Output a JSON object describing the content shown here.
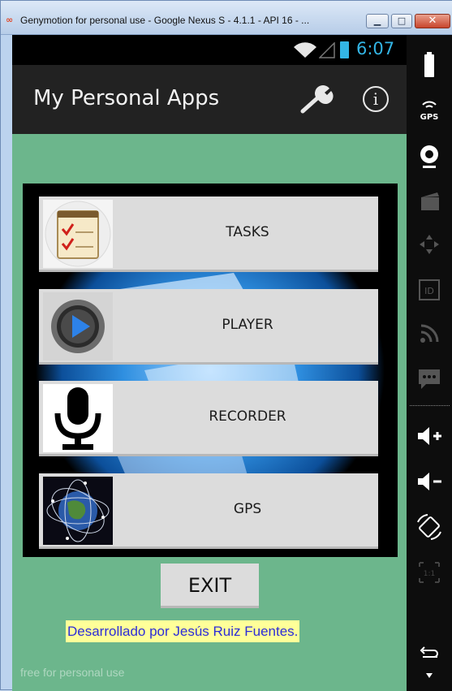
{
  "window": {
    "title": "Genymotion for personal use - Google Nexus S - 4.1.1 - API 16 - ...",
    "icon": "genymotion-logo-icon",
    "controls": [
      "minimize-icon",
      "maximize-icon",
      "close-icon"
    ]
  },
  "statusbar": {
    "time": "6:07",
    "icons": [
      "wifi-icon",
      "signal-icon",
      "battery-icon"
    ],
    "accent_color": "#33b5e5"
  },
  "actionbar": {
    "title": "My Personal Apps",
    "icons": [
      "wrench-icon",
      "info-icon"
    ],
    "info_glyph": "i"
  },
  "menu": {
    "items": [
      {
        "label": "TASKS",
        "icon": "tasks-notepad-icon"
      },
      {
        "label": "PLAYER",
        "icon": "play-button-icon"
      },
      {
        "label": "RECORDER",
        "icon": "microphone-icon"
      },
      {
        "label": "GPS",
        "icon": "globe-satellites-icon"
      }
    ]
  },
  "exit_label": "EXIT",
  "credit": "Desarrollado por Jesús Ruiz Fuentes.",
  "watermark": "free for personal use",
  "sidebar": {
    "icons": [
      "battery-icon",
      "gps-icon",
      "webcam-icon",
      "camera-icon",
      "dpad-icon",
      "id-icon",
      "rss-icon",
      "sms-icon",
      "volume-up-icon",
      "volume-down-icon",
      "rotate-icon",
      "scale-icon",
      "back-icon"
    ],
    "gps_label": "GPS",
    "id_label": "ID",
    "scale_label": "1:1"
  },
  "colors": {
    "device_bg": "#6cb68c",
    "actionbar_bg": "#222222",
    "button_bg": "#dcdcdc",
    "credit_bg": "#ffff99",
    "credit_text": "#2d2dd6"
  }
}
